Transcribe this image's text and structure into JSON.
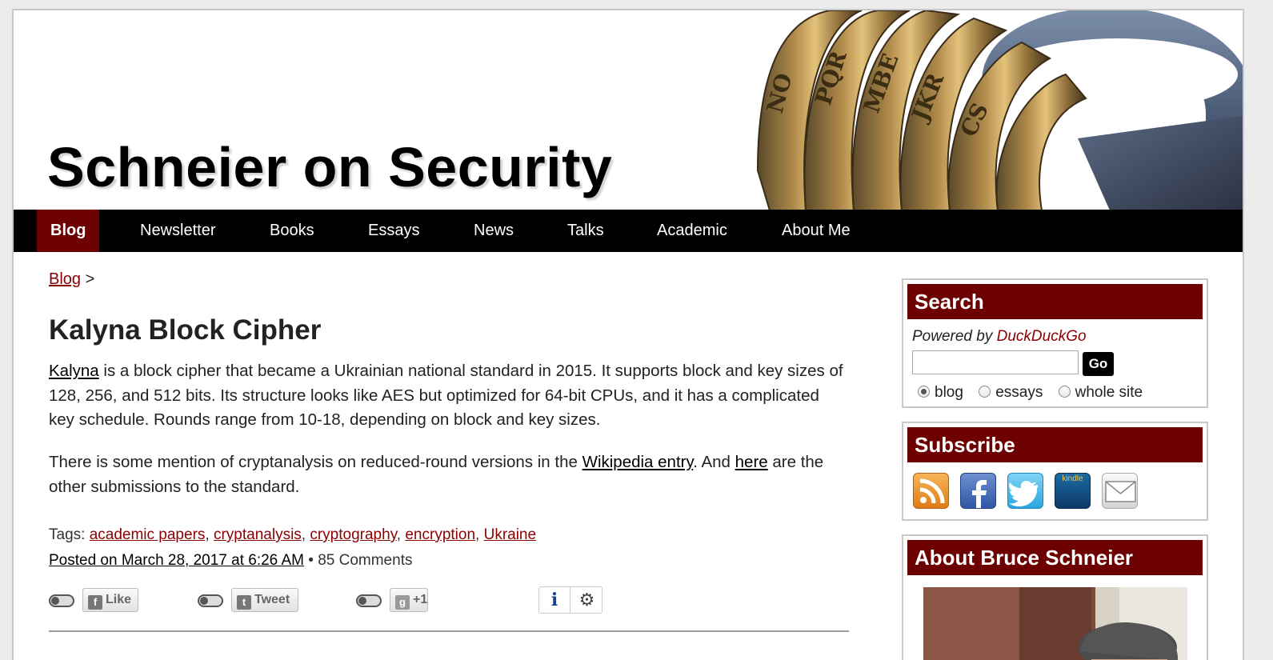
{
  "site": {
    "title": "Schneier on Security"
  },
  "nav": {
    "items": [
      {
        "label": "Blog",
        "active": true
      },
      {
        "label": "Newsletter"
      },
      {
        "label": "Books"
      },
      {
        "label": "Essays"
      },
      {
        "label": "News"
      },
      {
        "label": "Talks"
      },
      {
        "label": "Academic"
      },
      {
        "label": "About Me"
      }
    ]
  },
  "breadcrumb": {
    "link": "Blog",
    "separator": ">"
  },
  "post": {
    "title": "Kalyna Block Cipher",
    "p1_link": "Kalyna",
    "p1_text": " is a block cipher that became a Ukrainian national standard in 2015. It supports block and key sizes of 128, 256, and 512 bits. Its structure looks like AES but optimized for 64-bit CPUs, and it has a complicated key schedule. Rounds range from 10-18, depending on block and key sizes.",
    "p2_pre": "There is some mention of cryptanalysis on reduced-round versions in the ",
    "p2_link1": "Wikipedia entry",
    "p2_mid": ". And ",
    "p2_link2": "here",
    "p2_post": " are the other submissions to the standard.",
    "tags_label": "Tags: ",
    "tags": [
      "academic papers",
      "cryptanalysis",
      "cryptography",
      "encryption",
      "Ukraine"
    ],
    "tag_sep": ", ",
    "posted": "Posted on March 28, 2017 at 6:26 AM",
    "bullet": " • ",
    "comments": "85 Comments"
  },
  "share": {
    "like": "Like",
    "tweet": "Tweet",
    "plusone": "+1",
    "info_icon": "info-icon",
    "settings_icon": "gear-icon"
  },
  "sidebar": {
    "search": {
      "title": "Search",
      "powered_prefix": "Powered by ",
      "powered_link": "DuckDuckGo",
      "input_value": "",
      "go_label": "Go",
      "options": [
        "blog",
        "essays",
        "whole site"
      ],
      "selected": "blog"
    },
    "subscribe": {
      "title": "Subscribe",
      "icons": [
        "rss-icon",
        "facebook-icon",
        "twitter-icon",
        "kindle-icon",
        "email-icon"
      ],
      "kindle_text": "kindle"
    },
    "about": {
      "title": "About Bruce Schneier"
    }
  },
  "colors": {
    "accent": "#6d0000",
    "link": "#8b0000",
    "nav_bg": "#000000"
  }
}
